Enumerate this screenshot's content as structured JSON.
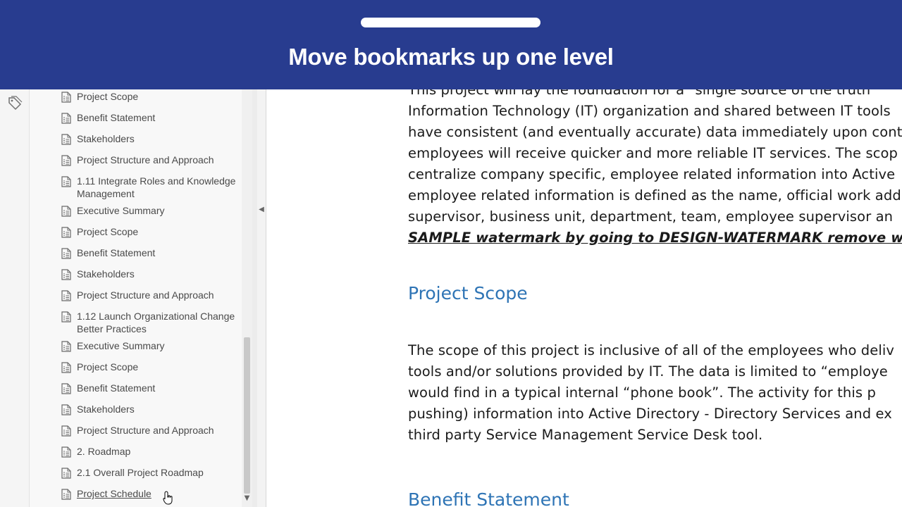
{
  "banner": {
    "title": "Move bookmarks up one level"
  },
  "bookmarks": [
    {
      "label": "Project Scope"
    },
    {
      "label": "Benefit Statement"
    },
    {
      "label": "Stakeholders"
    },
    {
      "label": "Project Structure and Approach"
    },
    {
      "label": "1.11 Integrate Roles and Knowledge Management"
    },
    {
      "label": "Executive Summary"
    },
    {
      "label": "Project Scope"
    },
    {
      "label": "Benefit Statement"
    },
    {
      "label": "Stakeholders"
    },
    {
      "label": "Project Structure and Approach"
    },
    {
      "label": "1.12 Launch Organizational Change Better Practices"
    },
    {
      "label": "Executive Summary"
    },
    {
      "label": "Project Scope"
    },
    {
      "label": "Benefit Statement"
    },
    {
      "label": "Stakeholders"
    },
    {
      "label": "Project Structure and Approach"
    },
    {
      "label": "2. Roadmap"
    },
    {
      "label": "2.1 Overall Project Roadmap"
    },
    {
      "label": "Project Schedule"
    }
  ],
  "document": {
    "para1": [
      "This project will lay the foundation for a \"single source of the truth\"",
      "Information Technology (IT) organization and shared between IT tools",
      "have consistent (and eventually accurate) data immediately upon cont",
      "employees will receive quicker and more reliable IT services.  The scop",
      "centralize company specific, employee related information into Active",
      "employee related information is defined as the name, official work add",
      "supervisor, business unit, department, team, employee supervisor an"
    ],
    "watermark": "SAMPLE watermark by going to DESIGN-WATERMARK remove wat",
    "heading1": "Project Scope",
    "para2": [
      "The scope of this project is inclusive of all of the employees who deliv",
      "tools and/or solutions provided by IT.  The data is limited to “employe",
      "would find in a typical internal “phone book”.  The activity for this p",
      "pushing) information into Active Directory - Directory Services and ex",
      "third party Service Management Service Desk tool."
    ],
    "heading2": "Benefit Statement"
  },
  "colors": {
    "banner": "#283c8f",
    "heading": "#2e74b5"
  },
  "icons": {
    "rail": "tag-icon",
    "bookmark": "bookmark-page-icon",
    "cursor": "hand-pointer-icon"
  }
}
